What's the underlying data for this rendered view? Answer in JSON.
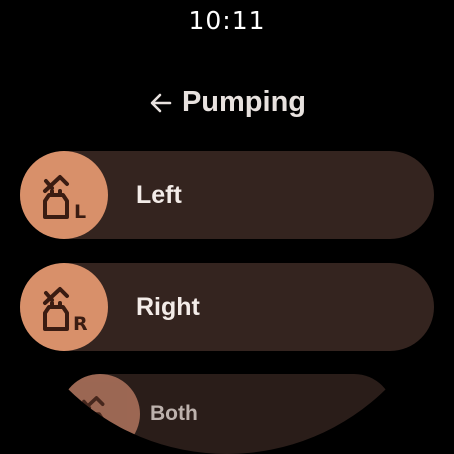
{
  "status": {
    "time": "10:11"
  },
  "header": {
    "title": "Pumping",
    "back_icon": "arrow-left-icon"
  },
  "options": [
    {
      "label": "Left",
      "badge": "L",
      "icon": "breast-pump-left-icon"
    },
    {
      "label": "Right",
      "badge": "R",
      "icon": "breast-pump-right-icon"
    },
    {
      "label": "Both",
      "icon": "breast-pump-both-icon"
    }
  ],
  "colors": {
    "chip_bg": "#34241f",
    "icon_bg": "#d8906a",
    "icon_fg": "#3a1c12",
    "text": "#f3ece8"
  }
}
